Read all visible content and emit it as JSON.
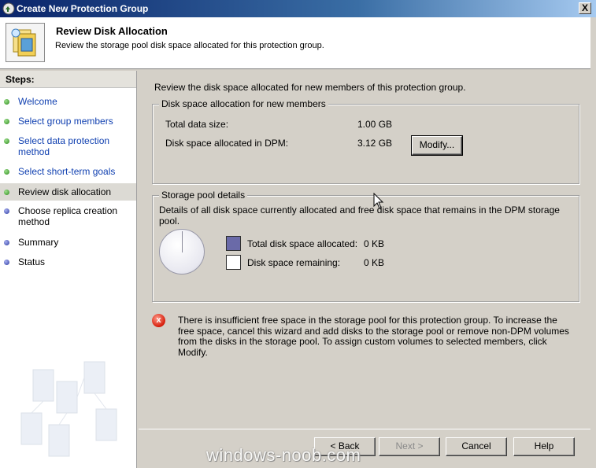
{
  "window": {
    "title": "Create New Protection Group",
    "close_glyph": "X"
  },
  "header": {
    "title": "Review Disk Allocation",
    "subtitle": "Review the storage pool disk space allocated for this protection group."
  },
  "steps": {
    "heading": "Steps:",
    "items": [
      {
        "label": "Welcome",
        "state": "done"
      },
      {
        "label": "Select group members",
        "state": "done"
      },
      {
        "label": "Select data protection method",
        "state": "done"
      },
      {
        "label": "Select short-term goals",
        "state": "done"
      },
      {
        "label": "Review disk allocation",
        "state": "current"
      },
      {
        "label": "Choose replica creation method",
        "state": "todo"
      },
      {
        "label": "Summary",
        "state": "todo"
      },
      {
        "label": "Status",
        "state": "todo"
      }
    ]
  },
  "main": {
    "intro": "Review the disk space allocated for new members of this protection group.",
    "allocation": {
      "legend": "Disk space allocation for new members",
      "total_label": "Total data size:",
      "total_value": "1.00 GB",
      "dpm_label": "Disk space allocated in DPM:",
      "dpm_value": "3.12 GB",
      "modify_label": "Modify..."
    },
    "pool": {
      "legend": "Storage pool details",
      "description": "Details of all disk space currently allocated and free disk space that remains in the DPM storage pool.",
      "allocated_label": "Total disk space allocated:",
      "allocated_value": "0 KB",
      "remaining_label": "Disk space remaining:",
      "remaining_value": "0 KB",
      "allocated_color": "#6a6aa8",
      "remaining_color": "#ffffff"
    },
    "error": {
      "icon": "error-icon",
      "glyph": "x",
      "message": "There is insufficient free space in the storage pool for this protection group. To increase the free space, cancel this wizard and add disks to the storage pool or remove non-DPM volumes from the disks in the storage pool. To assign custom volumes to selected members, click Modify."
    }
  },
  "buttons": {
    "back": "< Back",
    "next": "Next >",
    "cancel": "Cancel",
    "help": "Help"
  },
  "watermark": "windows-noob.com"
}
